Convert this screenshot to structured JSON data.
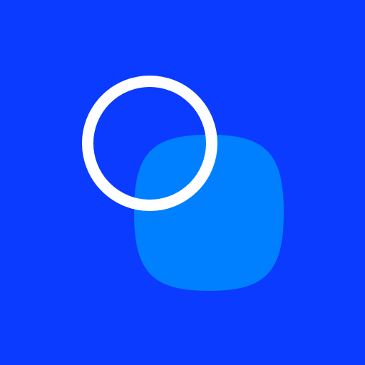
{
  "icon": {
    "name": "app-icon",
    "elements": [
      "background",
      "squircle",
      "ring"
    ],
    "colors": {
      "background": "#0B3BFF",
      "squircle": "#0080FF",
      "ring": "#FFFFFF"
    }
  }
}
